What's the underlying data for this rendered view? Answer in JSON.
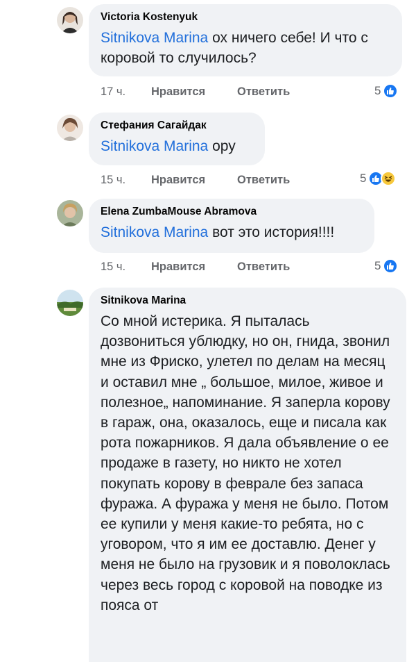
{
  "comments": [
    {
      "author": "Victoria Kostenyuk",
      "mention": "Sitnikova Marina",
      "text": " ох ничего себе! И что с коровой то случилось?",
      "time": "17 ч.",
      "like_label": "Нравится",
      "reply_label": "Ответить",
      "reaction_count": "5",
      "reactions": [
        "like-icon"
      ]
    },
    {
      "author": "Стефания Сагайдак",
      "mention": "Sitnikova Marina",
      "text": " ору",
      "time": "15 ч.",
      "like_label": "Нравится",
      "reply_label": "Ответить",
      "reaction_count": "5",
      "reactions": [
        "like-icon",
        "haha-icon"
      ]
    },
    {
      "author": "Elena ZumbaMouse Abramova",
      "mention": "Sitnikova Marina",
      "text": " вот это история!!!!",
      "time": "15 ч.",
      "like_label": "Нравится",
      "reply_label": "Ответить",
      "reaction_count": "5",
      "reactions": [
        "like-icon"
      ]
    },
    {
      "author": "Sitnikova Marina",
      "text": "Со мной истерика. Я пыталась дозвониться ублюдку, но он, гнида, звонил мне из Фриско, улетел по делам на месяц и оставил мне „ большое, милое, живое и полезное„ напоминание. Я заперла корову в гараж, она, оказалось, еще и писала как рота пожарников. Я дала объявление о ее продаже в газету, но никто не хотел покупать корову в феврале без запаса фуража. А фуража у меня не было. Потом ее купили у меня какие-то ребята, но с уговором, что я им ее доставлю. Денег у меня не было на грузовик и я поволоклась через весь город с коровой на поводке из пояса от"
    }
  ],
  "colors": {
    "mention": "#216fdb",
    "bubble": "#f0f2f5",
    "like": "#1877f2",
    "haha": "#f7c83c"
  }
}
